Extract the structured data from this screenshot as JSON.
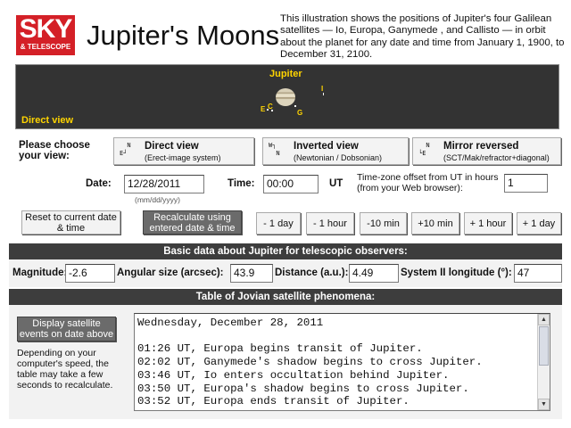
{
  "header": {
    "logo_top": "SKY",
    "logo_bottom": "& TELESCOPE",
    "title": "Jupiter's Moons",
    "intro": "This illustration shows the positions of Jupiter's four Galilean satellites — Io, Europa, Ganymede , and Callisto — in orbit about the planet for any date and time from January 1, 1900, to December 31, 2100."
  },
  "sky": {
    "planet_label": "Jupiter",
    "view_label": "Direct view",
    "moons": {
      "io": "I",
      "europa": "E",
      "callisto": "C",
      "ganymede": "G"
    }
  },
  "view_select": {
    "prompt": "Please choose your view:",
    "options": [
      {
        "orient": "  N\nE┘",
        "name": "Direct view",
        "sub": "(Erect-image system)"
      },
      {
        "orient": "W┐\n  N",
        "name": "Inverted view",
        "sub": "(Newtonian / Dobsonian)"
      },
      {
        "orient": "  N\n└E",
        "name": "Mirror reversed",
        "sub": "(SCT/Mak/refractor+diagonal)"
      }
    ]
  },
  "datetime": {
    "date_label": "Date:",
    "date_value": "12/28/2011",
    "date_hint": "(mm/dd/yyyy)",
    "time_label": "Time:",
    "time_value": "00:00",
    "ut_label": "UT",
    "tz_label": "Time-zone offset from UT in hours (from your Web browser):",
    "tz_value": "1"
  },
  "buttons": {
    "reset": "Reset to current date & time",
    "recalc": "Recalculate using entered date & time",
    "minus_day": "- 1 day",
    "minus_hour": "- 1 hour",
    "minus_10min": "-10 min",
    "plus_10min": "+10 min",
    "plus_hour": "+ 1 hour",
    "plus_day": "+ 1 day"
  },
  "basic": {
    "heading": "Basic data about Jupiter for telescopic observers:",
    "magnitude_label": "Magnitude:",
    "magnitude": "-2.6",
    "angular_label": "Angular size (arcsec):",
    "angular": "43.9",
    "distance_label": "Distance (a.u.):",
    "distance": "4.49",
    "longitude_label": "System II longitude (°):",
    "longitude": "47"
  },
  "phenomena": {
    "heading": "Table of Jovian satellite phenomena:",
    "display_button": "Display satellite events on date above",
    "note": "Depending on your computer's speed, the table may take a few seconds to recalculate.",
    "events_text": "Wednesday, December 28, 2011\n\n01:26 UT, Europa begins transit of Jupiter.\n02:02 UT, Ganymede's shadow begins to cross Jupiter.\n03:46 UT, Io enters occultation behind Jupiter.\n03:50 UT, Europa's shadow begins to cross Jupiter.\n03:52 UT, Europa ends transit of Jupiter."
  },
  "icons": {
    "scroll_up": "scroll-up-arrow",
    "scroll_down": "scroll-down-arrow"
  },
  "colors": {
    "logo_red": "#d42027",
    "sky_bg": "#333333",
    "label_yellow": "#ffd400",
    "bar_dark": "#3d3d3d"
  }
}
